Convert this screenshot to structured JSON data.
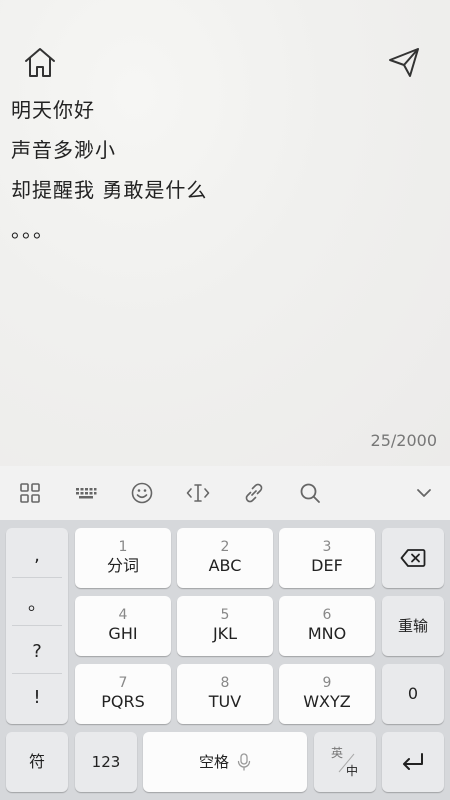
{
  "note": {
    "lines": [
      "明天你好",
      "声音多渺小",
      "却提醒我 勇敢是什么",
      "。。。"
    ],
    "counter": "25/2000"
  },
  "toolbar": {
    "icons": [
      "grid-icon",
      "keyboard-icon",
      "emoji-icon",
      "cursor-icon",
      "link-icon",
      "search-icon",
      "chevron-down-icon"
    ]
  },
  "keyboard": {
    "punct": [
      ",",
      "。",
      "?",
      "!"
    ],
    "keys": [
      {
        "num": "1",
        "label": "分词"
      },
      {
        "num": "2",
        "label": "ABC"
      },
      {
        "num": "3",
        "label": "DEF"
      },
      {
        "num": "4",
        "label": "GHI"
      },
      {
        "num": "5",
        "label": "JKL"
      },
      {
        "num": "6",
        "label": "MNO"
      },
      {
        "num": "7",
        "label": "PQRS"
      },
      {
        "num": "8",
        "label": "TUV"
      },
      {
        "num": "9",
        "label": "WXYZ"
      }
    ],
    "reenter": "重输",
    "zero": "0",
    "symbols": "符",
    "numbers": "123",
    "space": "空格",
    "lang_top": "英",
    "lang_bottom": "中"
  }
}
